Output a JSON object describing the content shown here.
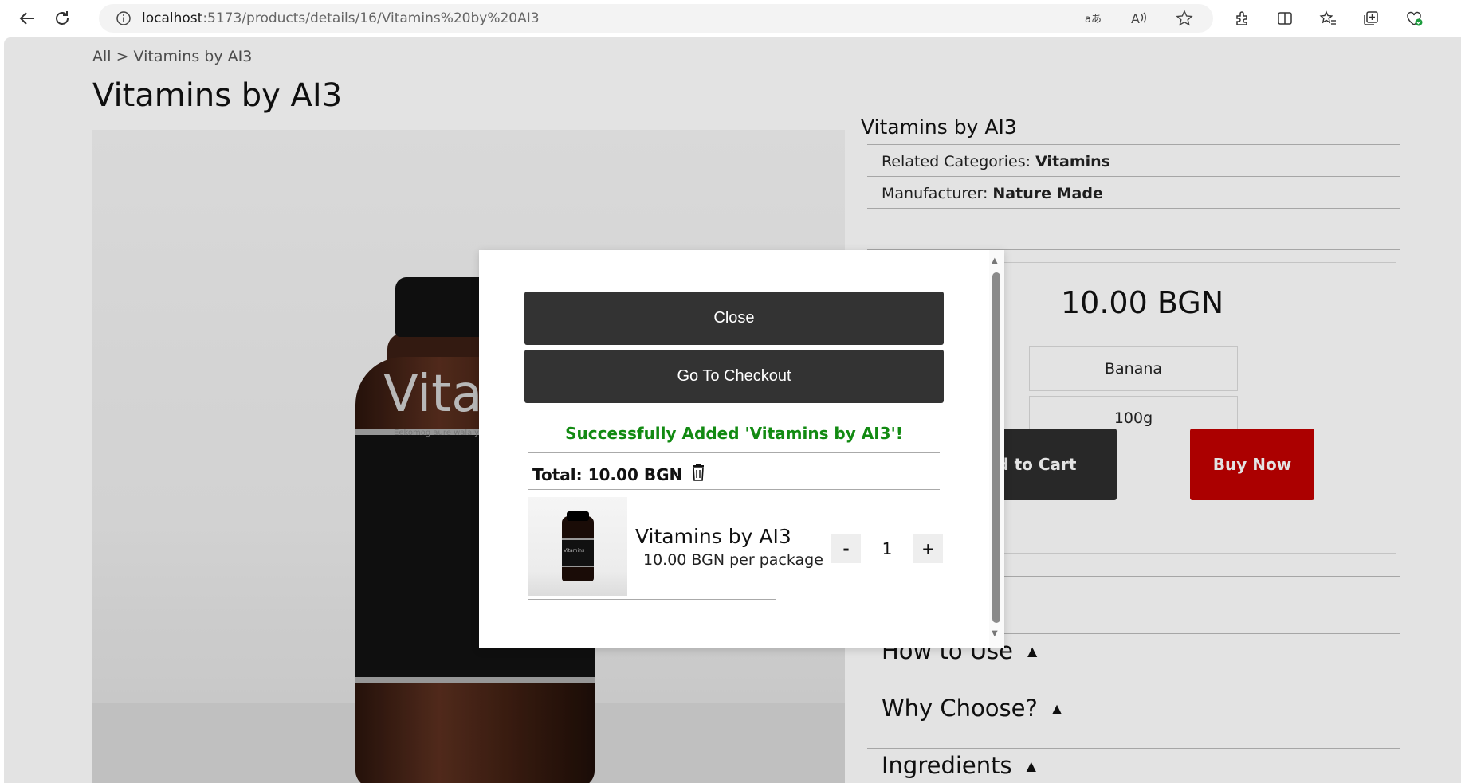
{
  "browser": {
    "url_host": "localhost",
    "url_rest": ":5173/products/details/16/Vitamins%20by%20AI3"
  },
  "page": {
    "breadcrumb": "All > Vitamins by AI3",
    "title": "Vitamins by AI3",
    "hero_label": "Vitar",
    "hero_sublabel": "Eekomog aure walaly nea"
  },
  "product": {
    "name": "Vitamins by AI3",
    "categories_label": "Related Categories: ",
    "categories_value": "Vitamins",
    "manufacturer_label": "Manufacturer: ",
    "manufacturer_value": "Nature Made",
    "price": "10.00 BGN",
    "options": [
      "Banana",
      "100g"
    ],
    "add_to_cart": "Add to Cart",
    "buy_now": "Buy Now",
    "accordions": [
      "How to Use",
      "Why Choose?",
      "Ingredients"
    ]
  },
  "modal": {
    "close_label": "Close",
    "checkout_label": "Go To Checkout",
    "success_message": "Successfully Added 'Vitamins by AI3'!",
    "total_label": "Total: 10.00 BGN",
    "item": {
      "thumb_label": "Vitamins",
      "name": "Vitamins by AI3",
      "price": "10.00 BGN per package",
      "quantity": "1",
      "minus": "-",
      "plus": "+"
    }
  },
  "colors": {
    "success": "#128a12",
    "buy_now": "#c00000",
    "dark_button": "#333333"
  },
  "icons": [
    "back-arrow-icon",
    "refresh-icon",
    "info-icon",
    "translate-icon",
    "read-aloud-icon",
    "favorite-star-icon",
    "extensions-icon",
    "split-screen-icon",
    "favorites-icon",
    "collections-icon",
    "browser-essentials-icon",
    "trash-icon"
  ]
}
